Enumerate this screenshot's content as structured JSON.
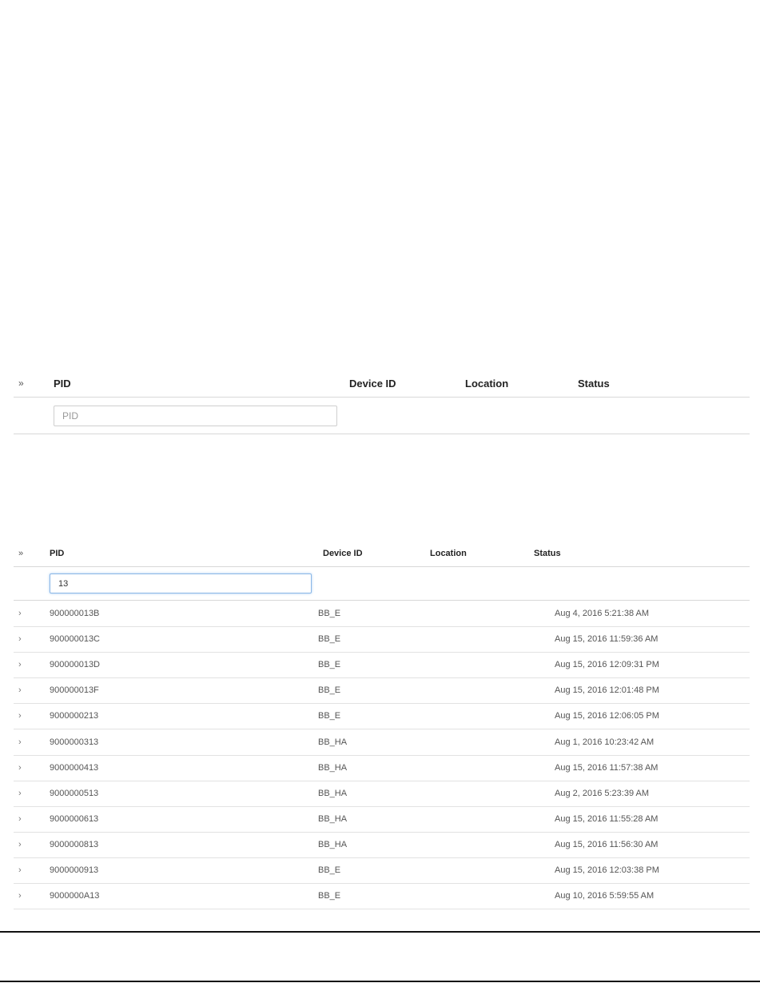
{
  "grid1": {
    "expand_all_icon": "»",
    "columns": {
      "pid": "PID",
      "device_id": "Device ID",
      "location": "Location",
      "status": "Status"
    },
    "filter": {
      "placeholder": "PID",
      "value": ""
    }
  },
  "grid2": {
    "expand_all_icon": "»",
    "columns": {
      "pid": "PID",
      "device_id": "Device ID",
      "location": "Location",
      "status": "Status"
    },
    "filter": {
      "placeholder": "PID",
      "value": "13"
    },
    "row_expand_icon": "›",
    "rows": [
      {
        "pid": "900000013B",
        "device_id": "BB_E",
        "location": "",
        "status": "Aug 4, 2016 5:21:38 AM"
      },
      {
        "pid": "900000013C",
        "device_id": "BB_E",
        "location": "",
        "status": "Aug 15, 2016 11:59:36 AM"
      },
      {
        "pid": "900000013D",
        "device_id": "BB_E",
        "location": "",
        "status": "Aug 15, 2016 12:09:31 PM"
      },
      {
        "pid": "900000013F",
        "device_id": "BB_E",
        "location": "",
        "status": "Aug 15, 2016 12:01:48 PM"
      },
      {
        "pid": "9000000213",
        "device_id": "BB_E",
        "location": "",
        "status": "Aug 15, 2016 12:06:05 PM"
      },
      {
        "pid": "9000000313",
        "device_id": "BB_HA",
        "location": "",
        "status": "Aug 1, 2016 10:23:42 AM"
      },
      {
        "pid": "9000000413",
        "device_id": "BB_HA",
        "location": "",
        "status": "Aug 15, 2016 11:57:38 AM"
      },
      {
        "pid": "9000000513",
        "device_id": "BB_HA",
        "location": "",
        "status": "Aug 2, 2016 5:23:39 AM"
      },
      {
        "pid": "9000000613",
        "device_id": "BB_HA",
        "location": "",
        "status": "Aug 15, 2016 11:55:28 AM"
      },
      {
        "pid": "9000000813",
        "device_id": "BB_HA",
        "location": "",
        "status": "Aug 15, 2016 11:56:30 AM"
      },
      {
        "pid": "9000000913",
        "device_id": "BB_E",
        "location": "",
        "status": "Aug 15, 2016 12:03:38 PM"
      },
      {
        "pid": "9000000A13",
        "device_id": "BB_E",
        "location": "",
        "status": "Aug 10, 2016 5:59:55 AM"
      }
    ]
  }
}
